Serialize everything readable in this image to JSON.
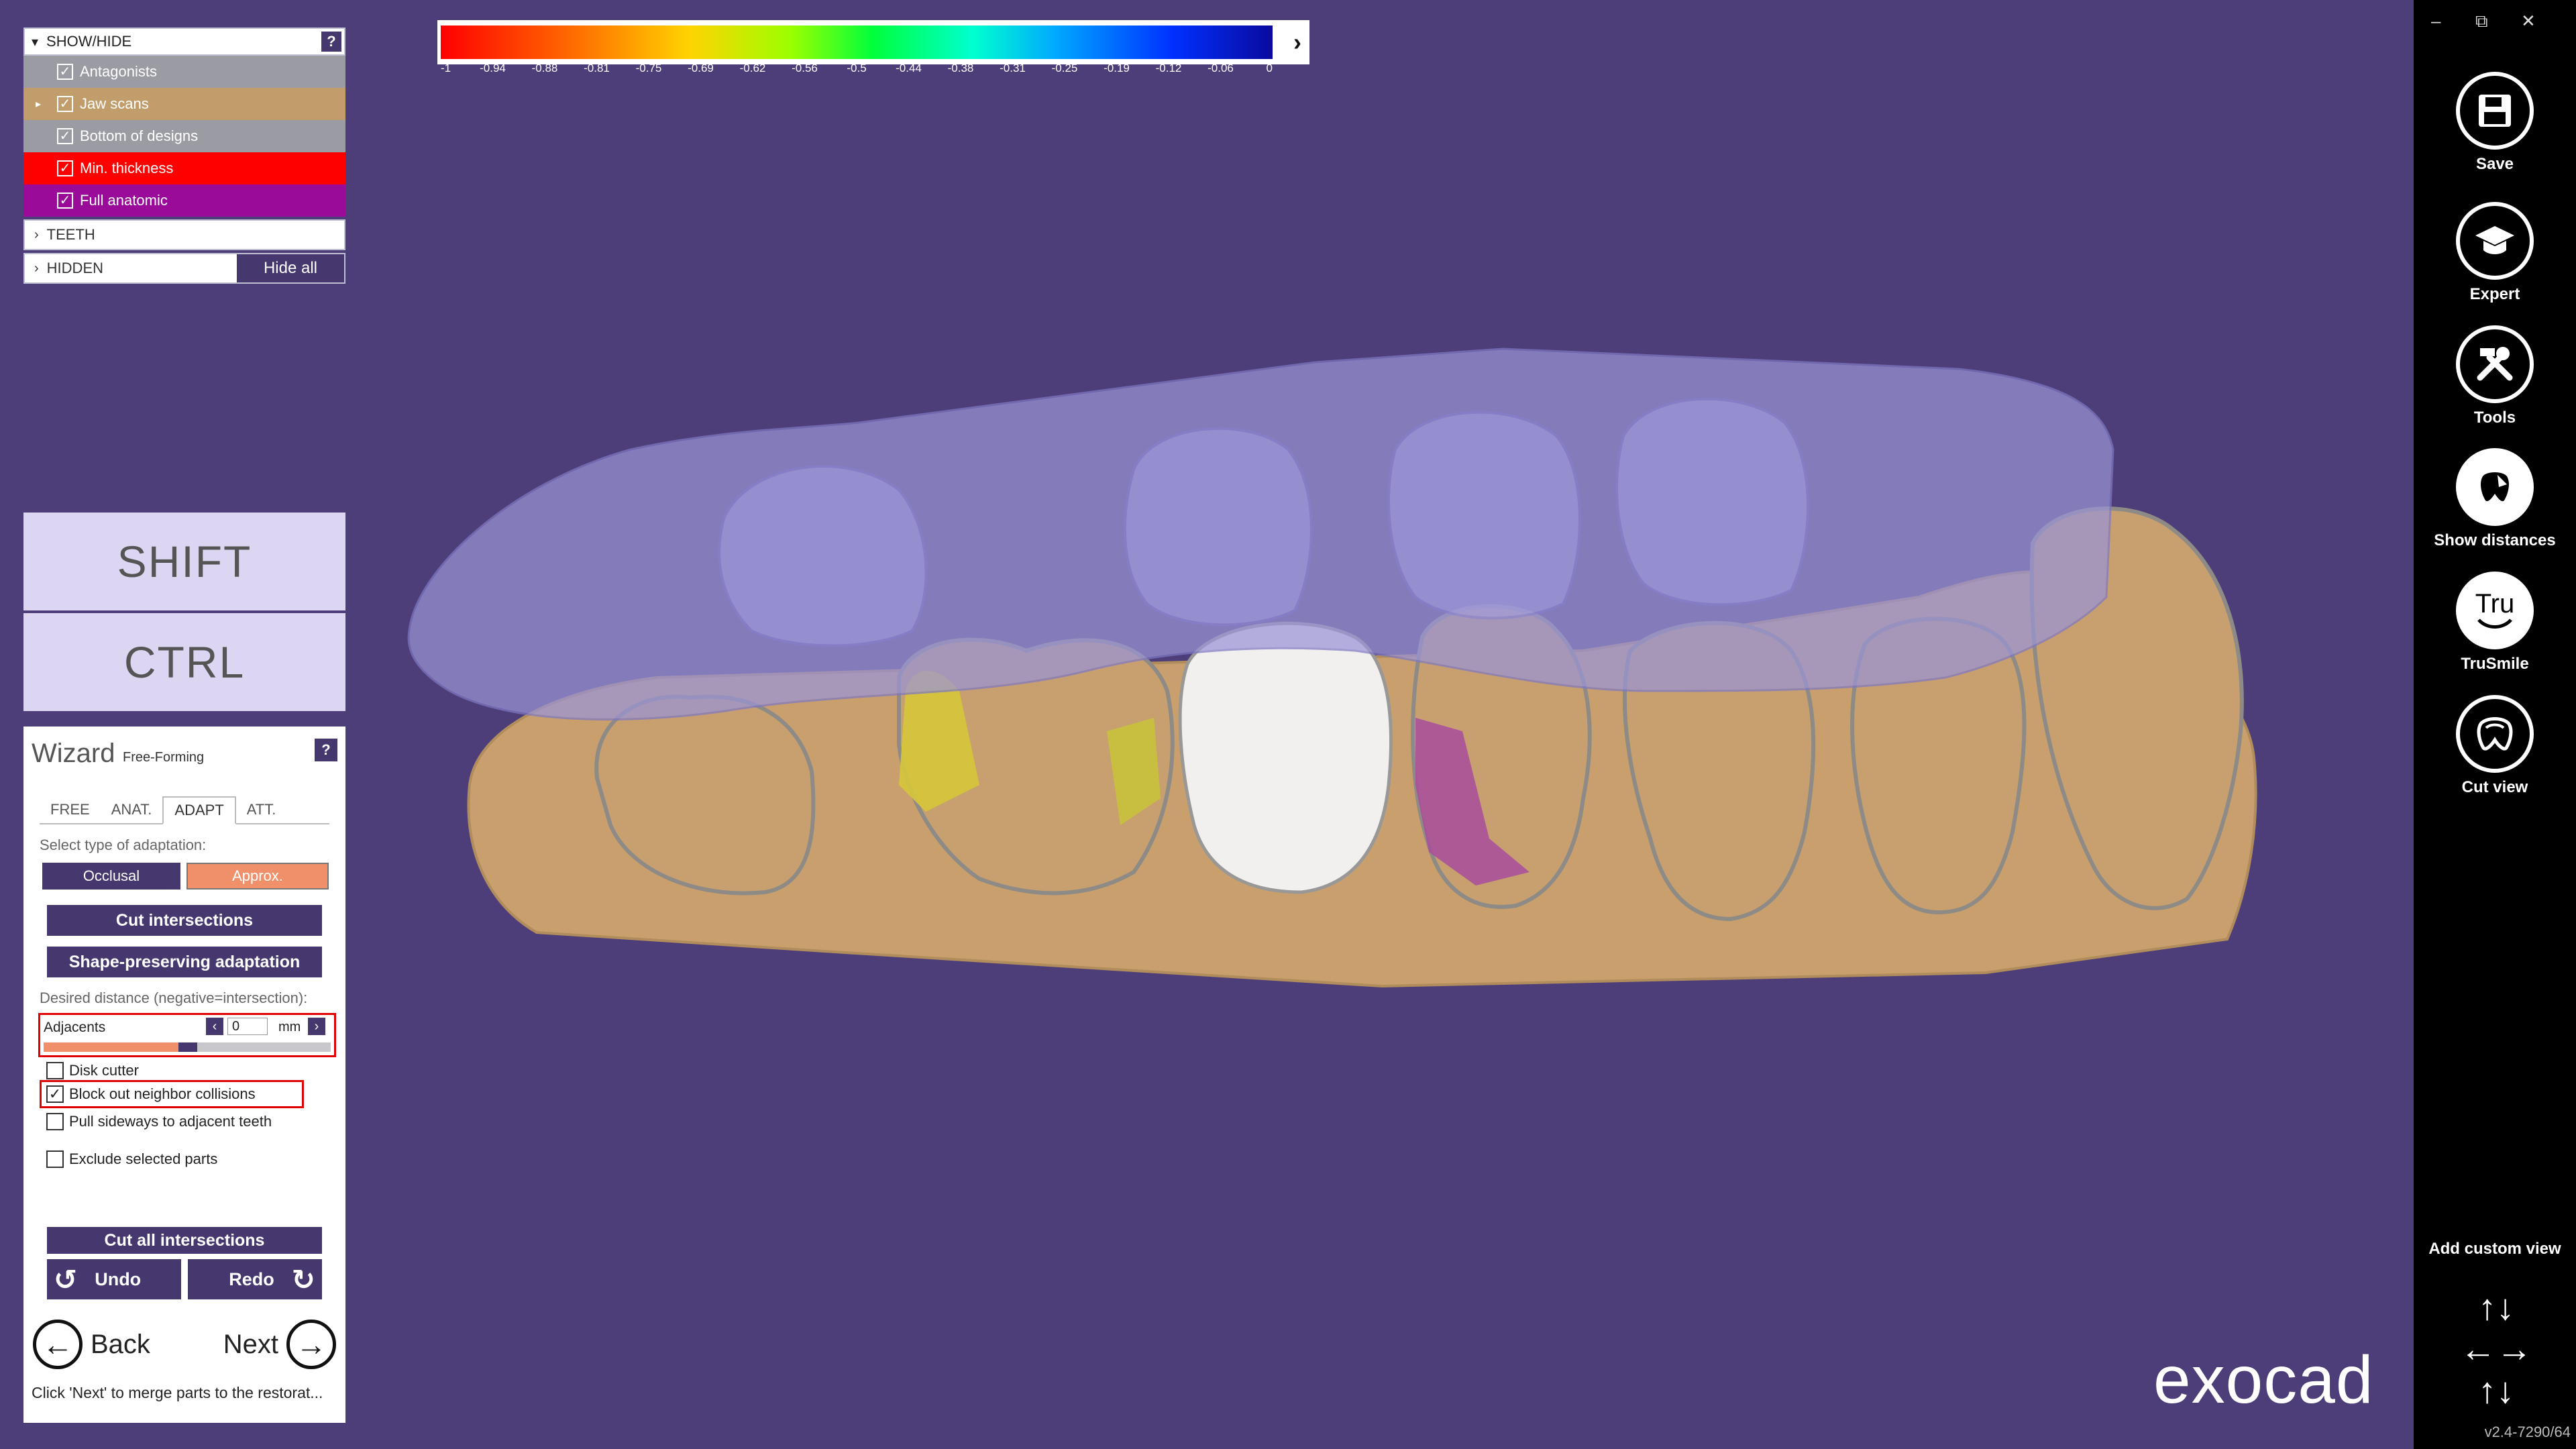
{
  "show_hide": {
    "title": "SHOW/HIDE",
    "help": "?",
    "items": [
      {
        "label": "Antagonists",
        "color": "#9b9ba4",
        "checked": true,
        "expandable": false
      },
      {
        "label": "Jaw scans",
        "color": "#c19d6b",
        "checked": true,
        "expandable": true
      },
      {
        "label": "Bottom of designs",
        "color": "#9b9ba4",
        "checked": true,
        "expandable": false
      },
      {
        "label": "Min. thickness",
        "color": "#ff0000",
        "checked": true,
        "expandable": false
      },
      {
        "label": "Full anatomic",
        "color": "#9a0b9a",
        "checked": true,
        "expandable": false
      }
    ],
    "teeth_label": "TEETH",
    "hidden_label": "HIDDEN",
    "hide_all_label": "Hide all"
  },
  "modifiers": {
    "shift": "SHIFT",
    "ctrl": "CTRL"
  },
  "wizard": {
    "title": "Wizard",
    "subtitle": "Free-Forming",
    "help": "?",
    "tabs": [
      "FREE",
      "ANAT.",
      "ADAPT",
      "ATT."
    ],
    "active_tab": "ADAPT",
    "adaptation_label": "Select type of adaptation:",
    "occlusal_label": "Occlusal",
    "approx_label": "Approx.",
    "cut_intersections_label": "Cut intersections",
    "shape_preserving_label": "Shape-preserving adaptation",
    "desired_distance_label": "Desired distance (negative=intersection):",
    "adjacents_label": "Adjacents",
    "adjacents_value": "0",
    "adjacents_unit": "mm",
    "adjacents_slider_fraction": 0.47,
    "options": [
      {
        "label": "Disk cutter",
        "checked": false
      },
      {
        "label": "Block out neighbor collisions",
        "checked": true
      },
      {
        "label": "Pull sideways to adjacent teeth",
        "checked": false
      },
      {
        "label": "Exclude selected parts",
        "checked": false
      }
    ],
    "cut_all_label": "Cut all intersections",
    "undo_label": "Undo",
    "redo_label": "Redo",
    "back_label": "Back",
    "next_label": "Next",
    "hint": "Click 'Next' to merge parts to the restorat..."
  },
  "color_scale": {
    "ticks": [
      "-1",
      "-0.94",
      "-0.88",
      "-0.81",
      "-0.75",
      "-0.69",
      "-0.62",
      "-0.56",
      "-0.5",
      "-0.44",
      "-0.38",
      "-0.31",
      "-0.25",
      "-0.19",
      "-0.12",
      "-0.06",
      "0"
    ]
  },
  "toolbar": {
    "tools": [
      {
        "label": "Save",
        "icon": "floppy-disk-icon"
      },
      {
        "label": "Expert",
        "icon": "graduation-cap-icon"
      },
      {
        "label": "Tools",
        "icon": "wrench-hammer-icon"
      },
      {
        "label": "Show distances",
        "icon": "tooth-distance-icon"
      },
      {
        "label": "TruSmile",
        "icon": "trusmile-icon",
        "glyph": "Tru"
      },
      {
        "label": "Cut view",
        "icon": "tooth-cut-icon"
      }
    ],
    "custom_view_label": "Add custom view",
    "version": "v2.4-7290/64"
  },
  "window_controls": {
    "minimize": "–",
    "restore": "⧉",
    "close": "✕"
  },
  "logo": "exocad",
  "colors": {
    "background": "#4d3d78",
    "accent": "#46386e",
    "approx": "#f0906a",
    "gum": "#c9a06d",
    "antagonist": "#9a94d6",
    "crown": "#f2f0ee"
  }
}
